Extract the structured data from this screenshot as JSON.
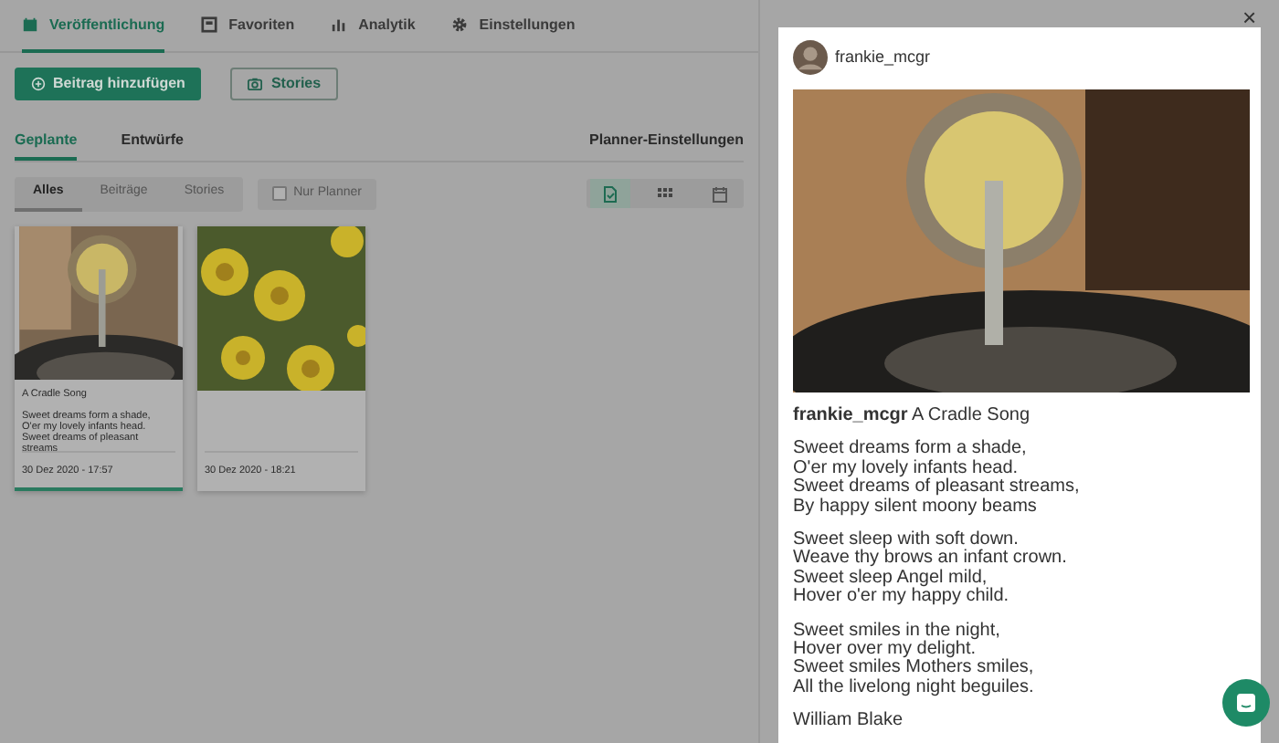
{
  "nav_tabs": [
    {
      "label": "Veröffentlichung",
      "selected": true
    },
    {
      "label": "Favoriten",
      "selected": false
    },
    {
      "label": "Analytik",
      "selected": false
    },
    {
      "label": "Einstellungen",
      "selected": false
    }
  ],
  "actions": [
    {
      "label": "Beitrag hinzufügen",
      "kind": "primary"
    },
    {
      "label": "Stories",
      "kind": "outline"
    }
  ],
  "subtabs": [
    {
      "label": "Geplante",
      "selected": true
    },
    {
      "label": "Entwürfe",
      "selected": false
    }
  ],
  "planner_settings": "Planner-Einstellungen",
  "filters": [
    {
      "label": "Alles",
      "selected": true
    },
    {
      "label": "Beiträge",
      "selected": false
    },
    {
      "label": "Stories",
      "selected": false
    }
  ],
  "planner_only": {
    "label": "Nur Planner",
    "checked": false
  },
  "view_modes": [
    {
      "selected": true
    },
    {
      "selected": false
    },
    {
      "selected": false
    }
  ],
  "posts": [
    {
      "kind": "gramophone",
      "title": "A Cradle Song",
      "excerpt": [
        "Sweet dreams form a shade,",
        "O'er my lovely infants head.",
        "Sweet dreams of pleasant streams"
      ],
      "date": "30 Dez 2020 - 17:57",
      "selected": true
    },
    {
      "kind": "flowers",
      "date": "30 Dez 2020 - 18:21",
      "selected": false
    }
  ],
  "preview": {
    "username": "frankie_mcgr",
    "close": "×",
    "caption_user": "frankie_mcgr",
    "caption_title": "A Cradle Song",
    "stanzas": [
      [
        "Sweet dreams form a shade,",
        "O'er my lovely infants head.",
        "Sweet dreams of pleasant streams,",
        "By happy silent moony beams"
      ],
      [
        "Sweet sleep with soft down.",
        "Weave thy brows an infant crown.",
        "Sweet sleep Angel mild,",
        "Hover o'er my happy child."
      ],
      [
        "Sweet smiles in the night,",
        "Hover over my delight.",
        "Sweet smiles Mothers smiles,",
        "All the livelong night beguiles."
      ]
    ],
    "author": "William Blake"
  }
}
